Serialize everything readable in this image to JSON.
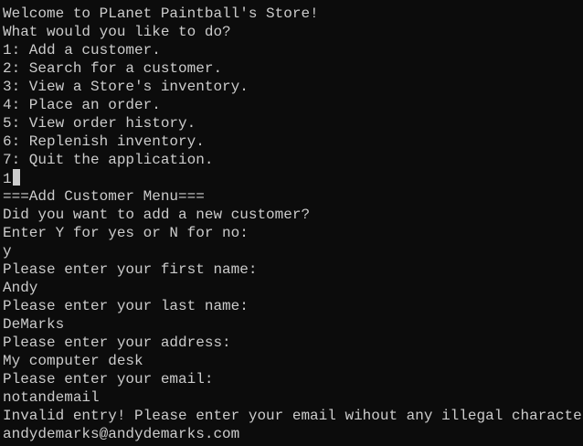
{
  "menu": {
    "welcome": "Welcome to PLanet Paintball's Store!",
    "prompt": "What would you like to do?",
    "options": [
      "1: Add a customer.",
      "2: Search for a customer.",
      "3: View a Store's inventory.",
      "4: Place an order.",
      "5: View order history.",
      "6: Replenish inventory.",
      "7: Quit the application."
    ],
    "selection": "1"
  },
  "add_customer": {
    "header": "===Add Customer Menu===",
    "confirm_question": "Did you want to add a new customer?",
    "confirm_prompt": "Enter Y for yes or N for no:",
    "confirm_input": "y",
    "first_name_prompt": "Please enter your first name:",
    "first_name_input": "Andy",
    "last_name_prompt": "Please enter your last name:",
    "last_name_input": "DeMarks",
    "address_prompt": "Please enter your address:",
    "address_input": "My computer desk",
    "email_prompt": "Please enter your email:",
    "email_input_invalid": "notandemail",
    "email_error": "Invalid entry! Please enter your email wihout any illegal characters:",
    "email_input": "andydemarks@andydemarks.com"
  },
  "colors": {
    "background": "#0c0c0c",
    "text": "#cccccc"
  }
}
